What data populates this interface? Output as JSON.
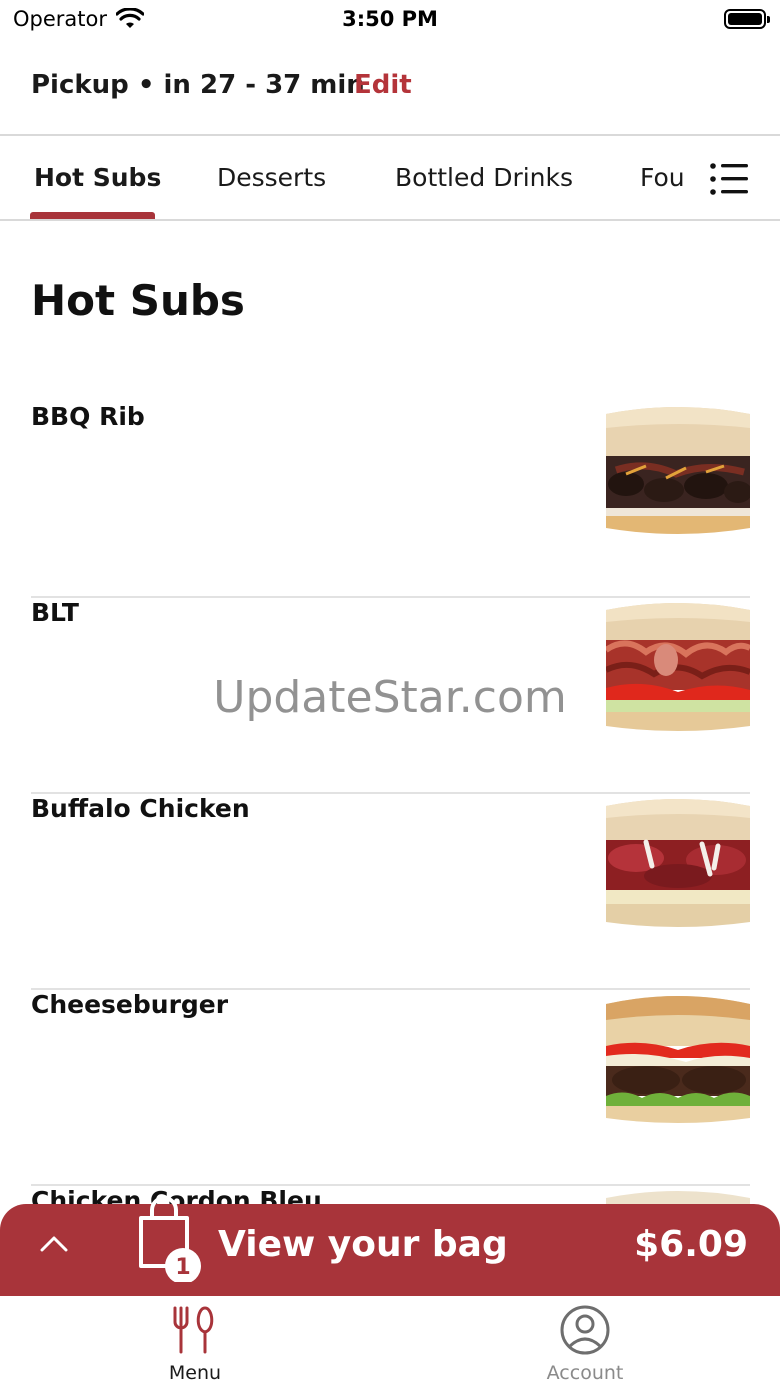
{
  "status_bar": {
    "carrier": "Operator",
    "time": "3:50 PM"
  },
  "header": {
    "pickup_text": "Pickup • in 27 - 37 min",
    "edit_label": "Edit"
  },
  "tabs": [
    {
      "label": "Hot Subs",
      "active": true
    },
    {
      "label": "Desserts",
      "active": false
    },
    {
      "label": "Bottled Drinks",
      "active": false
    },
    {
      "label": "Fou",
      "active": false
    }
  ],
  "section": {
    "title": "Hot Subs"
  },
  "items": [
    {
      "name": "BBQ Rib"
    },
    {
      "name": "BLT"
    },
    {
      "name": "Buffalo Chicken"
    },
    {
      "name": "Cheeseburger"
    },
    {
      "name": "Chicken Cordon Bleu"
    }
  ],
  "watermark": "UpdateStar.com",
  "bag": {
    "label": "View your bag",
    "count": "1",
    "total": "$6.09"
  },
  "nav": [
    {
      "label": "Menu",
      "icon": "fork-knife-icon",
      "active": true
    },
    {
      "label": "Account",
      "icon": "account-icon",
      "active": false
    }
  ],
  "colors": {
    "accent": "#a8343a",
    "edit": "#b4343a",
    "divider": "#d9d9d9",
    "inactive_nav": "#8a8a8a"
  }
}
